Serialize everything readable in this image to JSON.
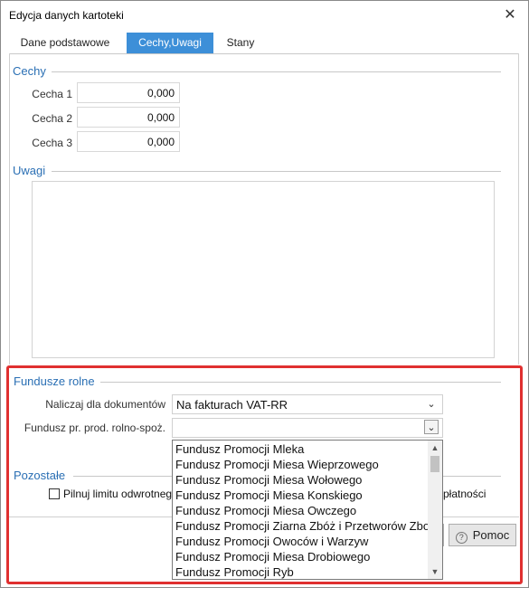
{
  "window": {
    "title": "Edycja danych kartoteki"
  },
  "tabs": [
    {
      "label": "Dane podstawowe",
      "active": false
    },
    {
      "label": "Cechy,Uwagi",
      "active": true
    },
    {
      "label": "Stany",
      "active": false
    }
  ],
  "cechy": {
    "title": "Cechy",
    "rows": [
      {
        "label": "Cecha 1",
        "value": "0,000"
      },
      {
        "label": "Cecha 2",
        "value": "0,000"
      },
      {
        "label": "Cecha 3",
        "value": "0,000"
      }
    ]
  },
  "uwagi": {
    "title": "Uwagi",
    "value": ""
  },
  "fundusze": {
    "title": "Fundusze rolne",
    "naliczaj_label": "Naliczaj dla dokumentów",
    "naliczaj_value": "Na fakturach VAT-RR",
    "fundusz_label": "Fundusz pr. prod. rolno-spoż.",
    "fundusz_value": "",
    "options": [
      "Fundusz Promocji Mleka",
      "Fundusz Promocji Miesa Wieprzowego",
      "Fundusz Promocji Miesa Wołowego",
      "Fundusz Promocji Miesa Konskiego",
      "Fundusz Promocji Miesa Owczego",
      "Fundusz Promocji Ziarna Zbóż i Przetworów Zbo",
      "Fundusz Promocji Owoców i Warzyw",
      "Fundusz Promocji Miesa Drobiowego",
      "Fundusz Promocji Ryb"
    ]
  },
  "pozostale": {
    "title": "Pozostałe",
    "checkbox_label": "Pilnuj limitu odwrotneg",
    "checkbox_checked": false,
    "partial_right_text": "płatności"
  },
  "buttons": {
    "help_label": "Pomoc"
  },
  "colors": {
    "accent": "#3d8fd8",
    "section_title": "#2a6fb4",
    "highlight": "#e03030"
  }
}
